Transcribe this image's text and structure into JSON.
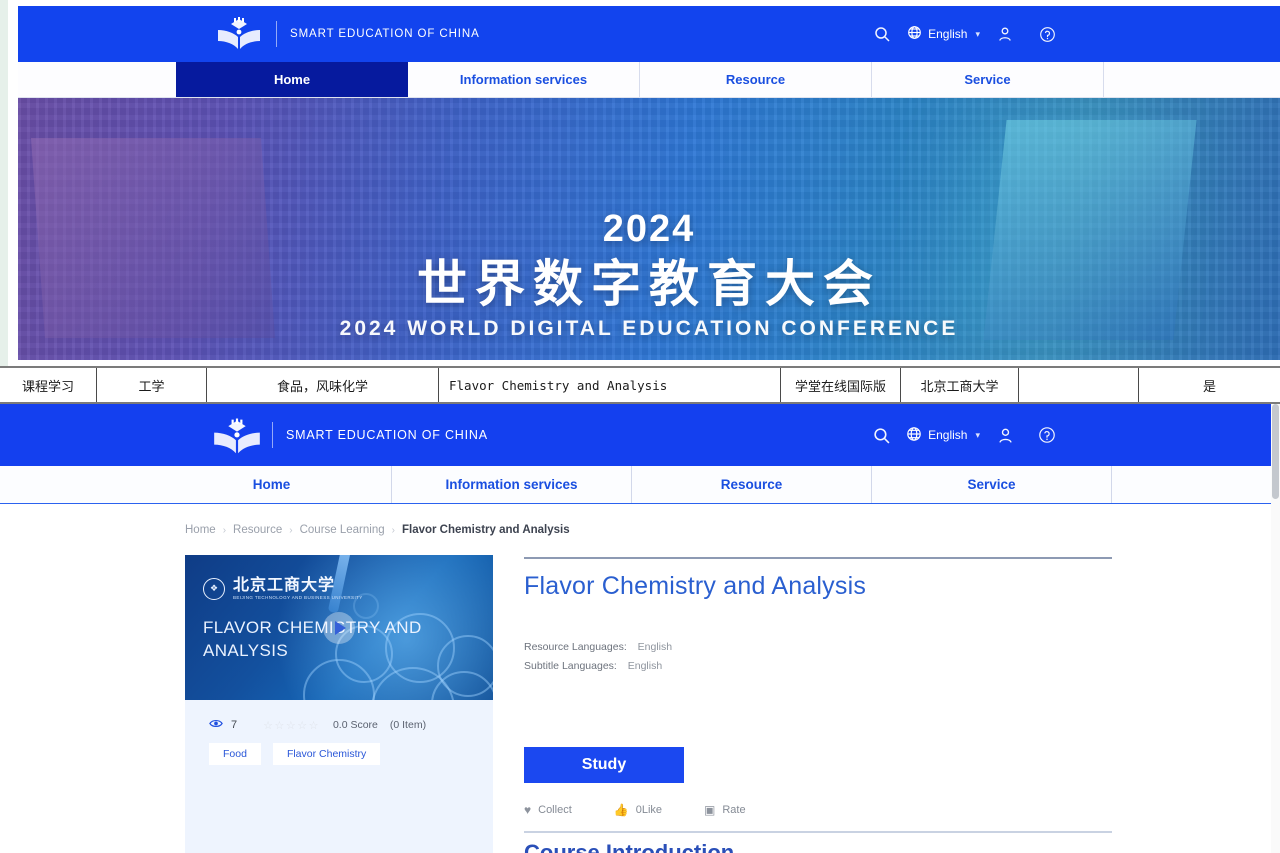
{
  "site": {
    "brand": "SMART EDUCATION OF CHINA",
    "logo_icon": "open-book-logo-icon",
    "accent_blue": "#1440ef",
    "active_nav_blue": "#061a9e"
  },
  "header": {
    "search_icon": "search-icon",
    "globe_icon": "globe-icon",
    "language": "English",
    "chevron_icon": "chevron-down-icon",
    "account_icon": "user-account-icon",
    "help_icon": "help-question-icon"
  },
  "nav": {
    "items": [
      {
        "label": "Home",
        "active": true
      },
      {
        "label": "Information services",
        "active": false
      },
      {
        "label": "Resource",
        "active": false
      },
      {
        "label": "Service",
        "active": false
      }
    ]
  },
  "banner": {
    "year": "2024",
    "title_cn": "世界数字教育大会",
    "title_en": "2024 WORLD DIGITAL EDUCATION CONFERENCE"
  },
  "sheet_row": {
    "cells": [
      "课程学习",
      "工学",
      "食品，风味化学",
      "Flavor Chemistry and Analysis",
      "学堂在线国际版",
      "北京工商大学",
      "",
      "是"
    ]
  },
  "breadcrumb": {
    "items": [
      "Home",
      "Resource",
      "Course Learning"
    ],
    "current": "Flavor Chemistry and Analysis",
    "separator": "›"
  },
  "course_card": {
    "thumbnail": {
      "university_cn": "北京工商大学",
      "university_en": "BEIJING TECHNOLOGY AND BUSINESS UNIVERSITY",
      "seal_icon": "university-seal-icon",
      "overlay_title": "FLAVOR CHEMISTRY AND ANALYSIS",
      "play_icon": "play-button-icon"
    },
    "views_icon": "eye-icon",
    "views": "7",
    "stars": "☆☆☆☆☆",
    "score": "0.0 Score",
    "item_count": "(0 Item)",
    "tags": [
      "Food",
      "Flavor Chemistry"
    ]
  },
  "detail": {
    "title": "Flavor Chemistry and Analysis",
    "meta": [
      {
        "key": "Resource Languages:",
        "value": "English"
      },
      {
        "key": "Subtitle Languages:",
        "value": "English"
      }
    ],
    "study_label": "Study",
    "actions": [
      {
        "icon": "heart-icon",
        "label": "Collect"
      },
      {
        "icon": "thumbs-up-icon",
        "label": "0Like"
      },
      {
        "icon": "rate-comment-icon",
        "label": "Rate"
      }
    ],
    "section_title": "Course Introduction"
  }
}
